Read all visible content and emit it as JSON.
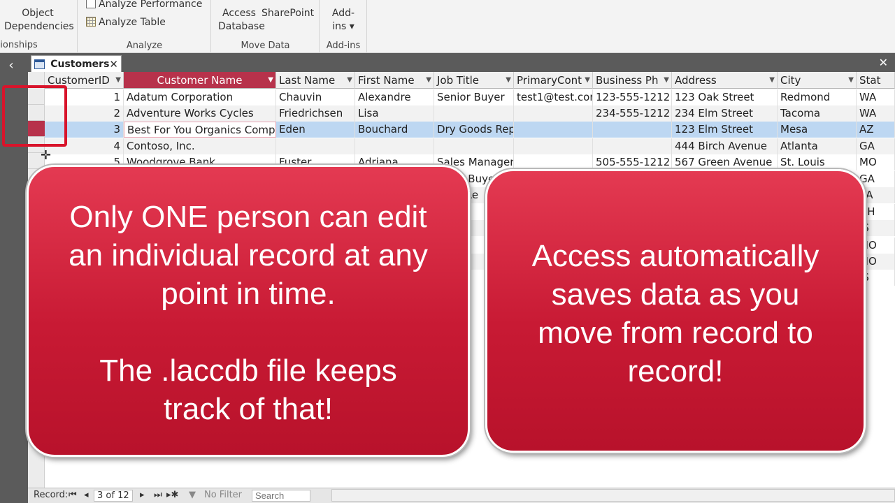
{
  "ribbon": {
    "relationships_partial": "ionships",
    "object_dependencies": [
      "Object",
      "Dependencies"
    ],
    "analyze_performance": "Analyze Performance",
    "analyze_table": "Analyze Table",
    "analyze_group": "Analyze",
    "access_database": [
      "Access",
      "Database"
    ],
    "sharepoint": "SharePoint",
    "move_data_group": "Move Data",
    "addins": [
      "Add-",
      "ins ▾"
    ],
    "addins_group": "Add-ins"
  },
  "tab": {
    "label": "Customers"
  },
  "columns": [
    "CustomerID",
    "Customer Name",
    "Last Name",
    "First Name",
    "Job Title",
    "PrimaryCont",
    "Business Ph",
    "Address",
    "City",
    "Stat"
  ],
  "rows": [
    {
      "id": "1",
      "name": "Adatum Corporation",
      "last": "Chauvin",
      "first": "Alexandre",
      "job": "Senior Buyer",
      "email": "test1@test.cor",
      "phone": "123-555-1212",
      "address": "123 Oak Street",
      "city": "Redmond",
      "state": "WA"
    },
    {
      "id": "2",
      "name": "Adventure Works Cycles",
      "last": "Friedrichsen",
      "first": "Lisa",
      "job": "",
      "email": "",
      "phone": "234-555-1212",
      "address": "234 Elm Street",
      "city": "Tacoma",
      "state": "WA"
    },
    {
      "id": "3",
      "name": "Best For You Organics Compar",
      "last": "Eden",
      "first": "Bouchard",
      "job": "Dry Goods Rep",
      "email": "",
      "phone": "",
      "address": "123 Elm Street",
      "city": "Mesa",
      "state": "AZ"
    },
    {
      "id": "4",
      "name": "Contoso, Inc.",
      "last": "",
      "first": "",
      "job": "",
      "email": "",
      "phone": "",
      "address": "444 Birch Avenue",
      "city": "Atlanta",
      "state": "GA"
    },
    {
      "id": "5",
      "name": "Woodgrove Bank",
      "last": "Fuster",
      "first": "Adriana",
      "job": "Sales Manager",
      "email": "",
      "phone": "505-555-1212",
      "address": "567 Green Avenue",
      "city": "St. Louis",
      "state": "MO"
    }
  ],
  "partial_cells": {
    "job": [
      "ior Buye",
      "or Re",
      "Bu",
      "ent",
      "ent",
      "ent",
      "ent"
    ],
    "state": [
      "GA",
      "VA",
      "NH",
      "IS",
      "MO",
      "MO",
      "IS"
    ]
  },
  "callouts": {
    "left": [
      "Only ONE person can edit",
      "an individual record at any",
      "point in time.",
      "",
      "The .laccdb file keeps",
      "track of that!"
    ],
    "right": [
      "Access automatically",
      "saves data as you",
      "move from record to",
      "record!"
    ]
  },
  "status": {
    "record_label": "Record:",
    "record_value": "3 of 12",
    "filter": "No Filter",
    "search_placeholder": "Search"
  }
}
